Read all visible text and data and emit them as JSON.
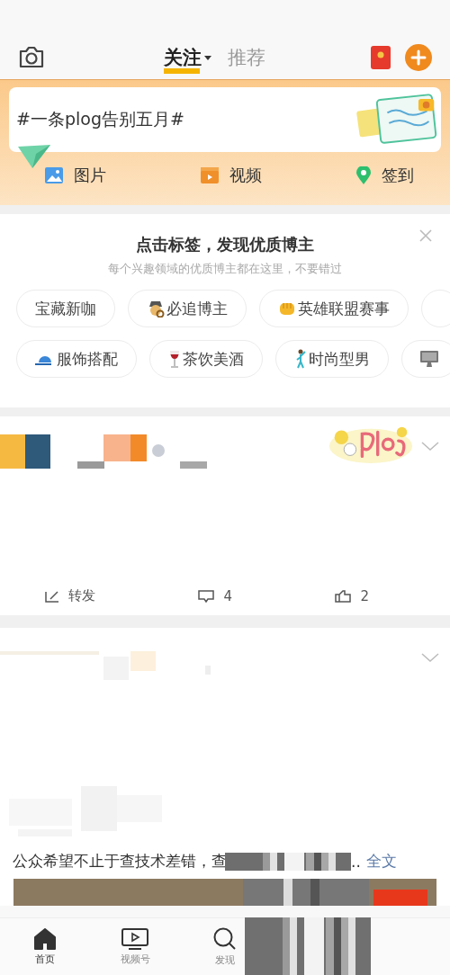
{
  "header": {
    "tabs": [
      {
        "label": "关注",
        "selected": true
      },
      {
        "label": "推荐",
        "selected": false
      }
    ]
  },
  "composer": {
    "topic": "#一条plog告别五月#",
    "actions": [
      {
        "label": "图片"
      },
      {
        "kind": "video",
        "label": "视频"
      },
      {
        "kind": "checkin",
        "label": "签到"
      }
    ]
  },
  "recommend": {
    "title": "点击标签，发现优质博主",
    "subtitle": "每个兴趣领域的优质博主都在这里，不要错过",
    "tag_rows": [
      [
        {
          "kind": "plain",
          "label": "宝藏新咖"
        },
        {
          "kind": "detective",
          "label": "必追博主"
        },
        {
          "kind": "fist",
          "label": "英雄联盟赛事"
        },
        {
          "kind": "plain"
        }
      ],
      [
        {
          "kind": "cap",
          "label": "服饰搭配"
        },
        {
          "kind": "wine",
          "label": "茶饮美酒"
        },
        {
          "kind": "dancer",
          "label": "时尚型男"
        },
        {
          "kind": "monitor"
        }
      ]
    ]
  },
  "posts": [
    {
      "kind": "sticker",
      "actions": [
        {
          "kind": "repost",
          "label": "转发"
        },
        {
          "kind": "comment",
          "label": "4"
        },
        {
          "kind": "like",
          "label": "2"
        }
      ]
    },
    {
      "kind": "article",
      "caption": "公众希望不止于查技术差错，查",
      "ellipsis": "..",
      "expand_link": "全文"
    }
  ],
  "bottom_nav": [
    {
      "kind": "home",
      "label": "首页",
      "selected": true
    },
    {
      "kind": "video",
      "label": "视频号",
      "selected": false
    },
    {
      "kind": "discover",
      "label": "发现",
      "selected": false
    }
  ]
}
